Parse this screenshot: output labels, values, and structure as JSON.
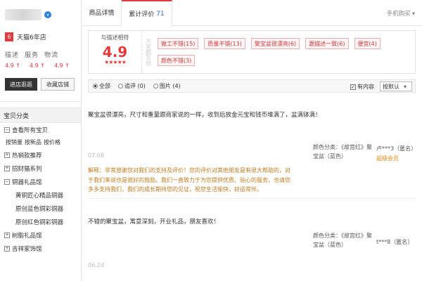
{
  "shop": {
    "verified_badge": "v",
    "years_number": "6",
    "years_label": "天猫6年店",
    "dsr_labels": [
      "描述",
      "服务",
      "物流"
    ],
    "dsr_values": [
      "4.9 ↑",
      "4.9 ↑",
      "4.9 ↑"
    ],
    "enter_button": "进店逛逛",
    "favorite_button": "收藏店铺"
  },
  "categories": {
    "title": "宝贝分类",
    "all": "查看所有宝贝",
    "sorts": [
      "按销量",
      "按新品",
      "按价格"
    ],
    "items": [
      {
        "label": "热销款推荐",
        "level": 1
      },
      {
        "label": "招财猫系列",
        "level": 1
      },
      {
        "label": "铜器礼品馆",
        "level": 1
      },
      {
        "label": "黄铜匠心精品铜器",
        "level": 2
      },
      {
        "label": "原创蓝色铜彩铜器",
        "level": 2
      },
      {
        "label": "原创红色铜彩铜器",
        "level": 2
      },
      {
        "label": "树脂礼品馆",
        "level": 1
      },
      {
        "label": "吉祥家饰馆",
        "level": 1
      }
    ]
  },
  "tabs": {
    "details": "商品详情",
    "reviews": "累计评价",
    "reviews_count": "71",
    "mobile": "手机购买",
    "mobile_arrow": "▾"
  },
  "summary": {
    "match_label": "与描述相符",
    "score": "4.9",
    "stars": "★★★★★",
    "impression_label": "大家都写到",
    "tags": [
      "做工不错(15)",
      "质量不错(13)",
      "聚宝盆很漂亮(6)",
      "跟描述一致(6)",
      "便宜(4)",
      "颜色不错(3)"
    ]
  },
  "filter": {
    "options": [
      "全部",
      "追评 (0)",
      "图片 (4)"
    ],
    "has_content": "有内容",
    "sort_value": "按默认",
    "sort_arrow": "▾"
  },
  "reviews": [
    {
      "text": "聚宝盆很漂亮，尺寸和重量跟商家说的一样，收到后放金元宝和钱币堆满了，盆满钵满！",
      "date": "07.08",
      "sku_lines": [
        "颜色分类：《故宫红》聚",
        "宝盆（蓝色）"
      ],
      "user": "卢***3（匿名）",
      "level": "超级会员",
      "reply": "解释：非常感谢您对我们的支持及评价！您的评价对其他朋友是有很大帮助的，对于我们来说也是很好的鼓励。我们一直致力于为您提供优质、贴心的服务，也请您多多支持我们，我们的成长期待您的见证，祝您生活愉快，好运常伴。"
    },
    {
      "text": "不错的聚宝盆，寓意深刻，开业礼品，朋友喜欢！",
      "date": "06.24",
      "sku_lines": [
        "颜色分类：《故宫红》聚",
        "宝盆（蓝色）"
      ],
      "user": "t***8（匿名）",
      "level": ""
    }
  ]
}
